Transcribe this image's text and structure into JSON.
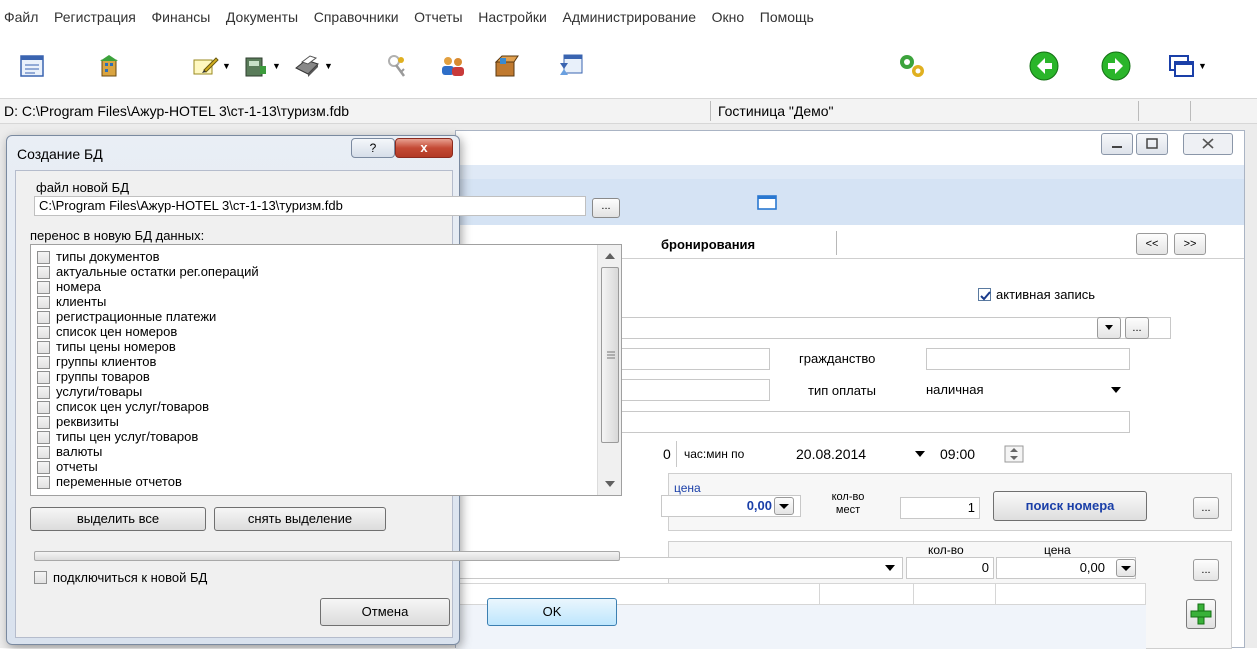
{
  "menu": [
    "Файл",
    "Регистрация",
    "Финансы",
    "Документы",
    "Справочники",
    "Отчеты",
    "Настройки",
    "Администрирование",
    "Окно",
    "Помощь"
  ],
  "statusbar": {
    "db_path": "D: C:\\Program Files\\Ажур-HOTEL 3\\ст-1-13\\туризм.fdb",
    "hotel": "Гостиница \"Демо\""
  },
  "background_window": {
    "tab_label": "бронирования",
    "nav_prev": "<<",
    "nav_next": ">>",
    "active_record_label": "активная запись",
    "active_record_checked": true,
    "citizenship_label": "гражданство",
    "payment_type_label": "тип оплаты",
    "payment_type_value": "наличная",
    "time_to_prefix": "0",
    "time_to_label": "час:мин по",
    "date_to": "20.08.2014",
    "time_to": "09:00",
    "price_label": "цена",
    "price_value": "0,00",
    "places_label": "кол-во мест",
    "places_value": "1",
    "search_room_button": "поиск номера",
    "ellipsis": "...",
    "qty_label": "кол-во",
    "qty_value": "0",
    "price2_label": "цена",
    "price2_value": "0,00"
  },
  "dialog": {
    "title": "Создание БД",
    "help": "?",
    "close": "x",
    "new_db_file_label": "файл новой БД",
    "new_db_file_value": "C:\\Program Files\\Ажур-HOTEL 3\\ст-1-13\\туризм.fdb",
    "browse": "...",
    "transfer_label": "перенос в новую БД данных:",
    "items": [
      "типы документов",
      "актуальные остатки рег.операций",
      "номера",
      "клиенты",
      "регистрационные платежи",
      "список цен номеров",
      "типы цены номеров",
      "группы клиентов",
      "группы товаров",
      "услуги/товары",
      "список цен услуг/товаров",
      "реквизиты",
      "типы цен услуг/товаров",
      "валюты",
      "отчеты",
      "переменные отчетов"
    ],
    "select_all": "выделить все",
    "deselect_all": "снять выделение",
    "connect_label": "подключиться к новой БД",
    "cancel": "Отмена",
    "ok": "OK"
  },
  "colors": {
    "accent_blue": "#1a3fa8",
    "green_nav": "#2ab52a",
    "dialog_close_red": "#c44a35"
  }
}
